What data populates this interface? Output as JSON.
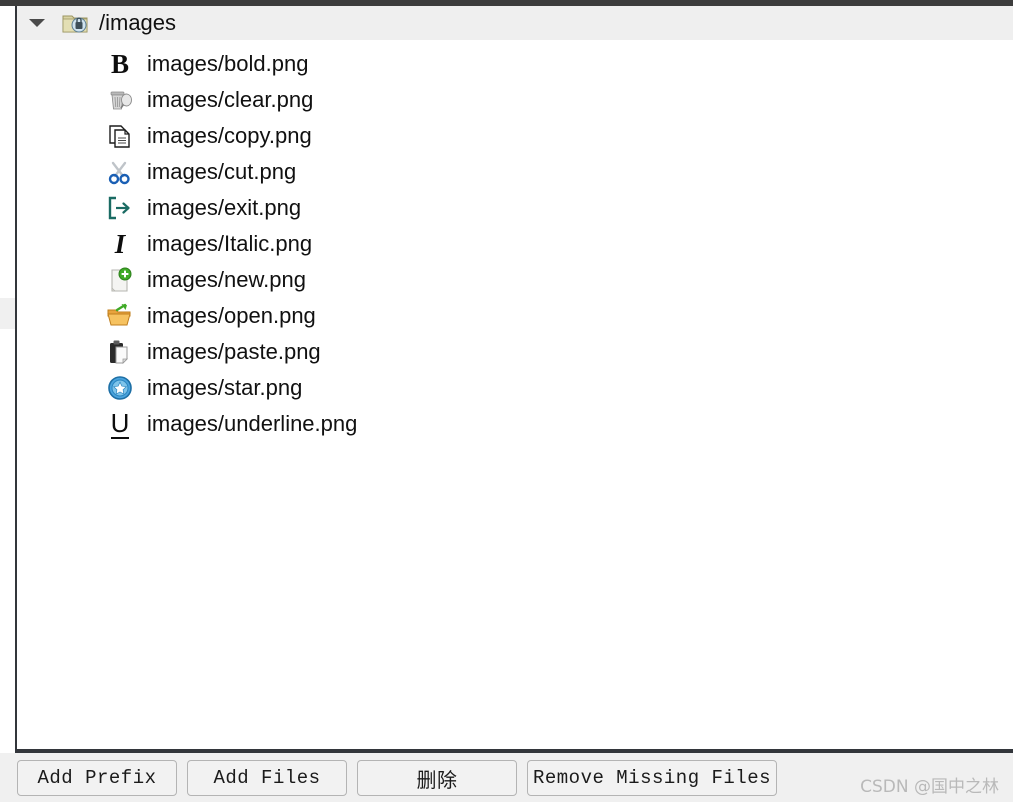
{
  "window": {
    "chrome_color": "#3c3c3c",
    "panel_background": "#ffffff",
    "border_color": "#33363b"
  },
  "tree": {
    "root": {
      "label": "/images",
      "icon": "folder-locked-icon",
      "disclosure": "chevron-down-icon",
      "expanded": true,
      "selected_background": "#efefef"
    },
    "files": [
      {
        "label": "images/bold.png",
        "icon": "bold-icon"
      },
      {
        "label": "images/clear.png",
        "icon": "trash-can-icon"
      },
      {
        "label": "images/copy.png",
        "icon": "copy-pages-icon"
      },
      {
        "label": "images/cut.png",
        "icon": "scissors-icon"
      },
      {
        "label": "images/exit.png",
        "icon": "exit-arrow-icon"
      },
      {
        "label": "images/Italic.png",
        "icon": "italic-icon"
      },
      {
        "label": "images/new.png",
        "icon": "new-document-icon"
      },
      {
        "label": "images/open.png",
        "icon": "open-folder-icon"
      },
      {
        "label": "images/paste.png",
        "icon": "clipboard-paste-icon"
      },
      {
        "label": "images/star.png",
        "icon": "star-badge-icon"
      },
      {
        "label": "images/underline.png",
        "icon": "underline-icon"
      }
    ]
  },
  "toolbar": {
    "add_prefix_label": "Add Prefix",
    "add_files_label": "Add Files",
    "delete_label": "删除",
    "remove_missing_label": "Remove Missing Files"
  },
  "watermark": {
    "text": "CSDN @国中之林",
    "color": "#b9b9b9"
  }
}
